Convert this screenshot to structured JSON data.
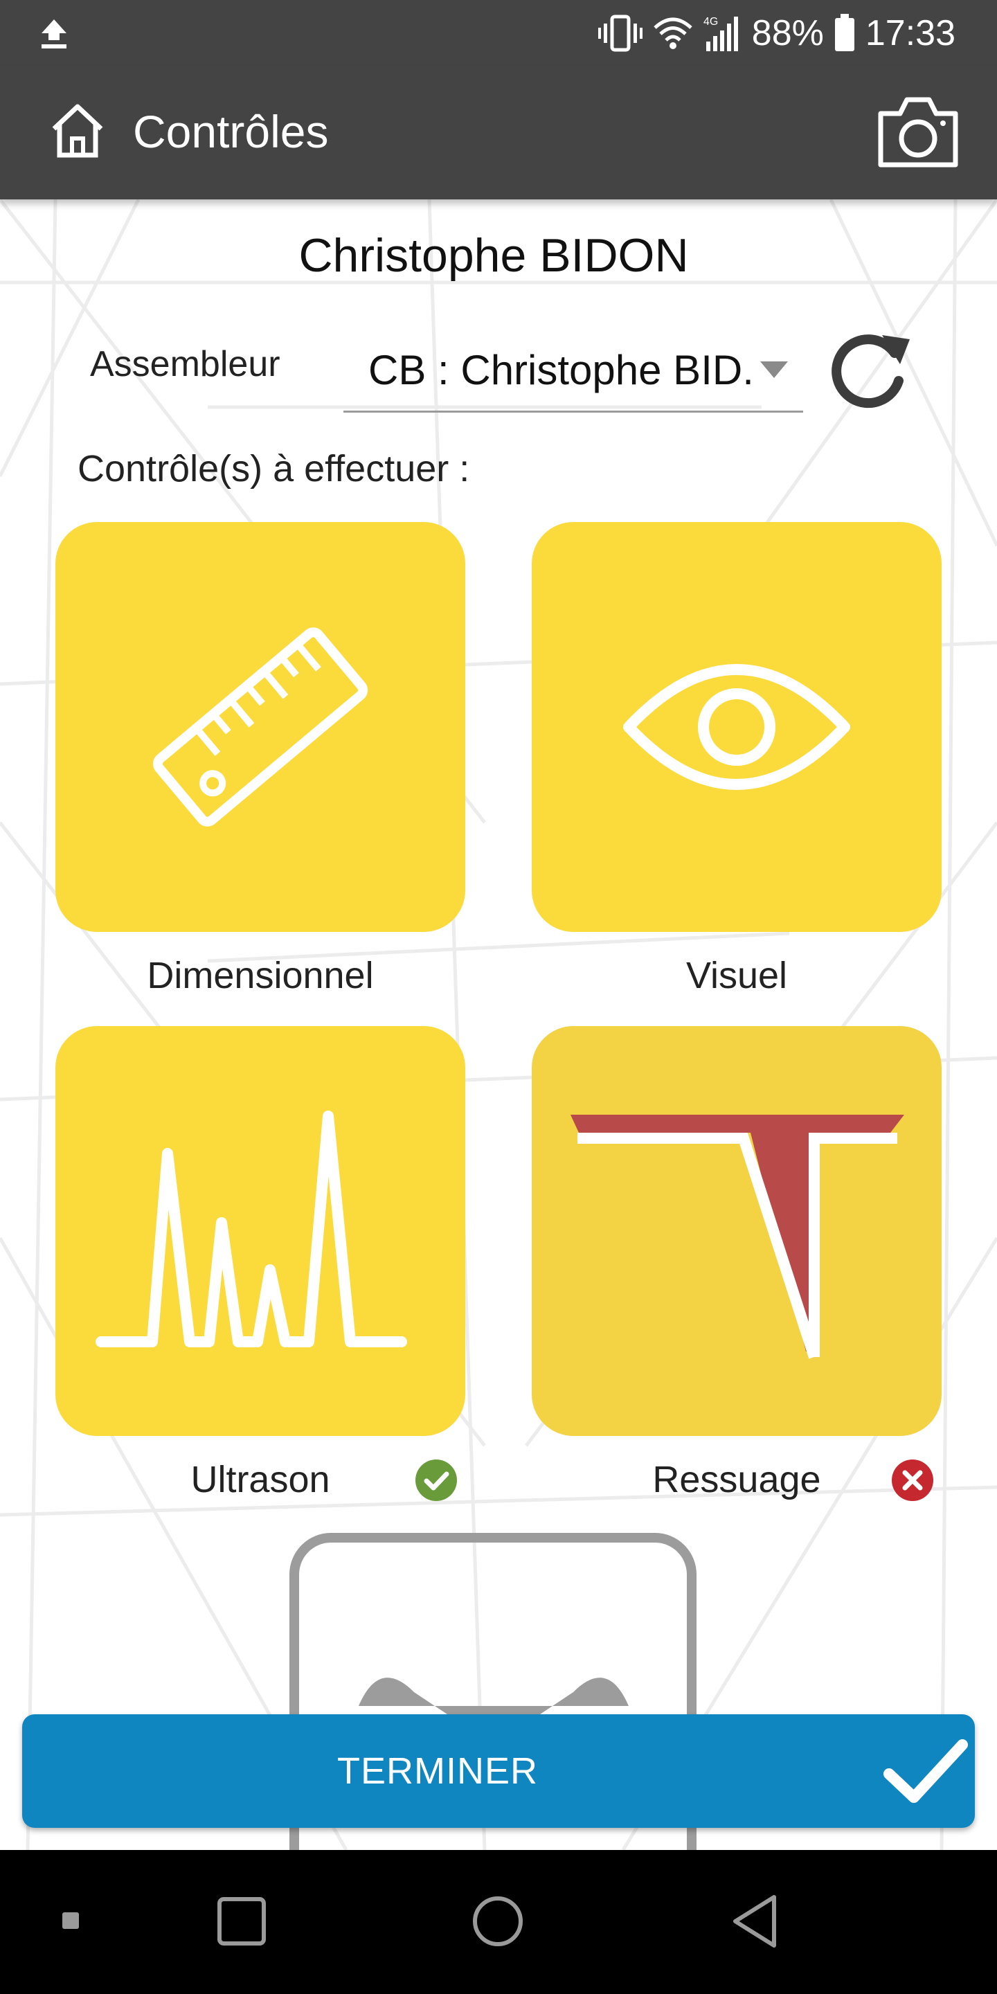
{
  "status_bar": {
    "battery": "88%",
    "time": "17:33",
    "network": "4G",
    "icons": [
      "upload-icon",
      "vibrate-icon",
      "wifi-icon",
      "signal-icon",
      "battery-icon"
    ]
  },
  "app_bar": {
    "title": "Contrôles",
    "home_icon": "home-icon",
    "camera_icon": "camera-icon"
  },
  "header": {
    "person_name": "Christophe BIDON",
    "assembleur_label": "Assembleur",
    "assembleur_selected": "CB : Christophe BID..",
    "refresh_icon": "refresh-icon",
    "controls_label": "Contrôle(s) à effectuer :"
  },
  "tiles": [
    {
      "label": "Dimensionnel",
      "icon": "ruler-icon",
      "status": null
    },
    {
      "label": "Visuel",
      "icon": "eye-icon",
      "status": null
    },
    {
      "label": "Ultrason",
      "icon": "ultrasound-wave-icon",
      "status": "ok"
    },
    {
      "label": "Ressuage",
      "icon": "penetrant-test-icon",
      "status": "ko"
    }
  ],
  "colors": {
    "bar": "#444444",
    "tile": "#fadb3b",
    "primary_button": "#0f86c0",
    "ok": "#6a9b3a",
    "ko": "#c62830",
    "ressuage_red": "#b94a4a"
  },
  "footer": {
    "terminer_label": "TERMINER",
    "check_icon": "check-icon"
  },
  "nav_bar": {
    "icons": [
      "recent-dot-icon",
      "overview-square-icon",
      "home-circle-icon",
      "back-triangle-icon"
    ]
  }
}
